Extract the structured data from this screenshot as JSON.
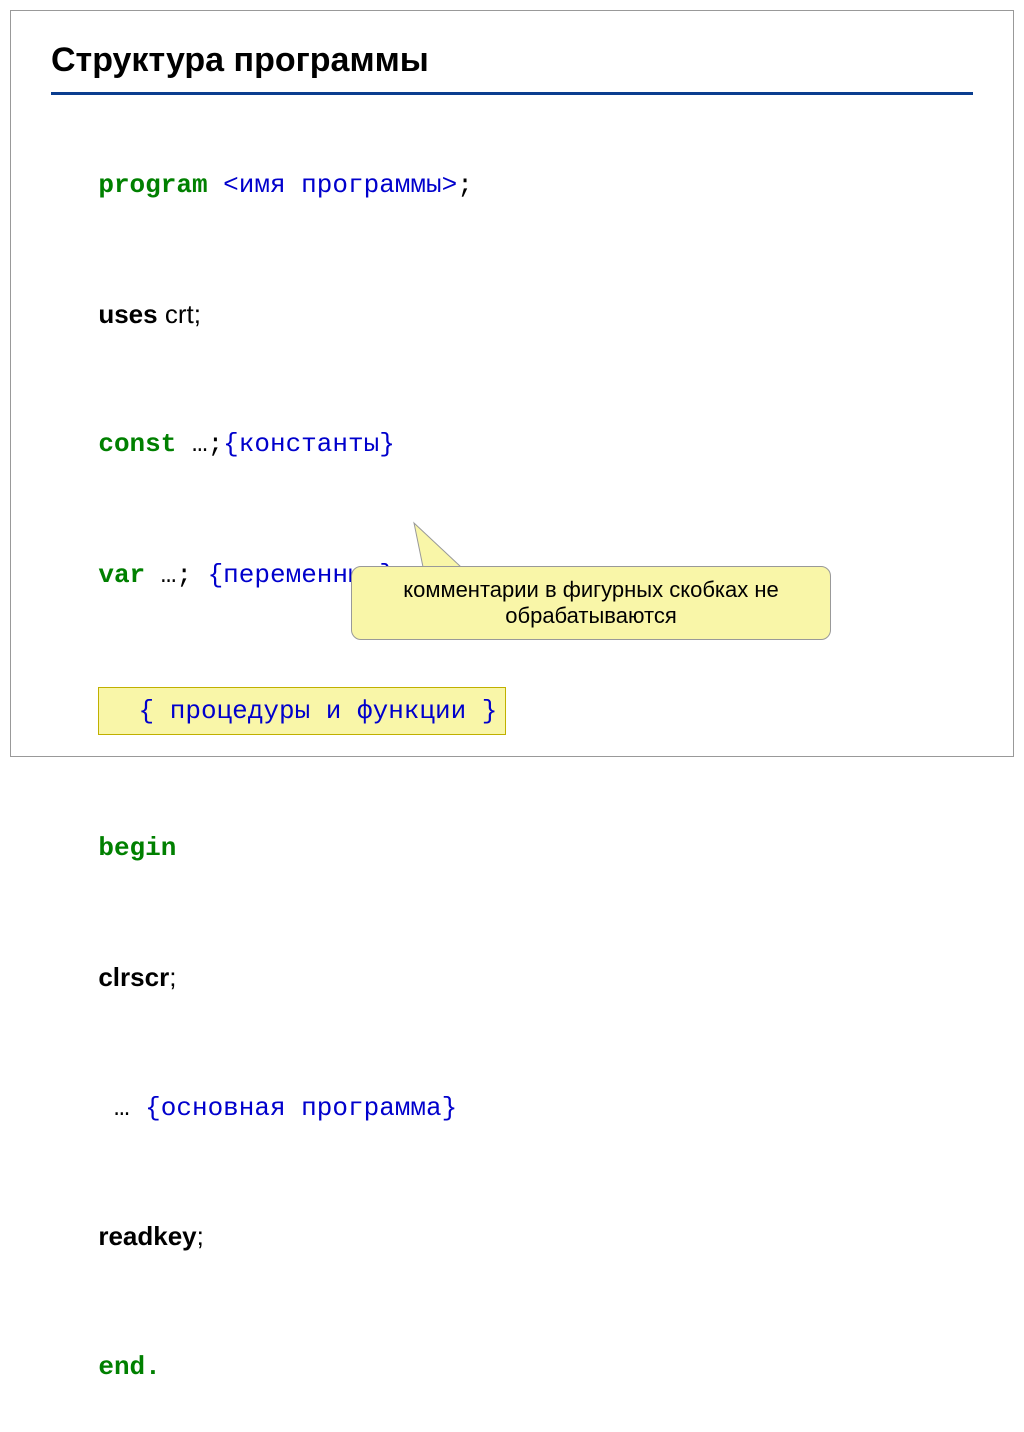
{
  "title": "Структура программы",
  "code": {
    "l1_kw": "program",
    "l1_arg": " <имя программы>",
    "l1_end": ";",
    "l2_kw": "uses ",
    "l2_val": "crt;",
    "l3_kw": "const",
    "l3_rest": " …;",
    "l3_comment": "{константы}",
    "l4_kw": "var",
    "l4_rest": " …; ",
    "l4_comment": "{переменные}",
    "l5_box": "  { процедуры и функции }",
    "l6_kw": "begin",
    "l7_kw": "clrscr",
    "l7_end": ";",
    "l8_pre": " … ",
    "l8_comment": "{основная программа}",
    "l9_kw": "readkey",
    "l9_end": ";",
    "l10_kw": "end."
  },
  "callout": "комментарии в фигурных скобках не обрабатываются"
}
